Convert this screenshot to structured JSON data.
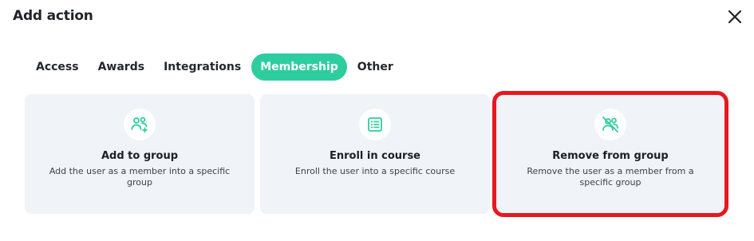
{
  "dialog": {
    "title": "Add action"
  },
  "tabs": [
    {
      "label": "Access"
    },
    {
      "label": "Awards"
    },
    {
      "label": "Integrations"
    },
    {
      "label": "Membership",
      "active": true
    },
    {
      "label": "Other"
    }
  ],
  "cards": [
    {
      "title": "Add to group",
      "description": "Add the user as a member into a specific group",
      "icon": "add-group-icon"
    },
    {
      "title": "Enroll in course",
      "description": "Enroll the user into a specific course",
      "icon": "course-list-icon"
    },
    {
      "title": "Remove from group",
      "description": "Remove the user as a member from a specific group",
      "icon": "remove-group-icon",
      "selected": true
    }
  ],
  "colors": {
    "accent": "#2ecda0",
    "selection": "#e8181e",
    "card_bg": "#f0f3f7"
  }
}
